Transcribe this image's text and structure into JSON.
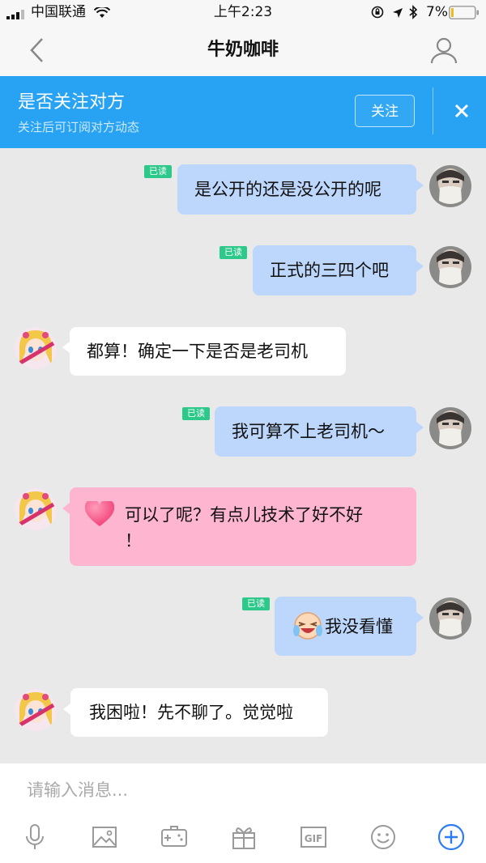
{
  "status_bar": {
    "carrier": "中国联通",
    "time": "上午2:23",
    "battery_percent": "7%"
  },
  "nav": {
    "title": "牛奶咖啡",
    "back_icon": "chevron-left-icon",
    "profile_icon": "user-icon"
  },
  "banner": {
    "title": "是否关注对方",
    "subtitle": "关注后可订阅对方动态",
    "follow_label": "关注",
    "close_icon": "close-icon"
  },
  "messages": [
    {
      "from": "me",
      "read_label": "已读",
      "text": "是公开的还是没公开的呢"
    },
    {
      "from": "me",
      "read_label": "已读",
      "text": "正式的三四个吧"
    },
    {
      "from": "other",
      "text": "都算！确定一下是否是老司机"
    },
    {
      "from": "me",
      "read_label": "已读",
      "text": "我可算不上老司机～"
    },
    {
      "from": "other",
      "style": "pink",
      "emoji": "heart-icon",
      "text_line1": "可以了呢？有点儿技术了好不好",
      "text_line2": "！"
    },
    {
      "from": "me",
      "read_label": "已读",
      "emoji": "laughing-crying-emoji-icon",
      "text": "我没看懂"
    },
    {
      "from": "other",
      "text": "我困啦！先不聊了。觉觉啦"
    }
  ],
  "input": {
    "placeholder": "请输入消息..."
  },
  "toolbar": {
    "icons": [
      "microphone-icon",
      "image-icon",
      "game-icon",
      "gift-icon",
      "gif-icon",
      "emoji-icon",
      "plus-icon"
    ]
  },
  "colors": {
    "banner_bg": "#28a3f4",
    "my_bubble": "#bcd6fc",
    "pink_bubble": "#feb5d0",
    "read_badge": "#2cc98b",
    "accent": "#2b7cf6"
  }
}
